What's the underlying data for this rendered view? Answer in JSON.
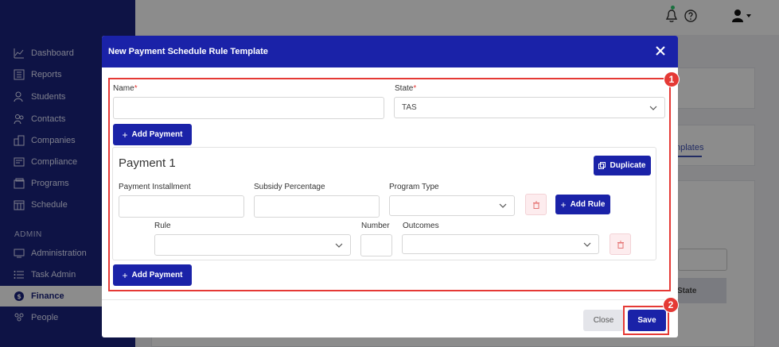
{
  "sidebar": {
    "items": [
      {
        "label": "Dashboard",
        "icon": "chart-line-icon"
      },
      {
        "label": "Reports",
        "icon": "report-icon"
      },
      {
        "label": "Students",
        "icon": "student-icon"
      },
      {
        "label": "Contacts",
        "icon": "contacts-icon"
      },
      {
        "label": "Companies",
        "icon": "building-icon"
      },
      {
        "label": "Compliance",
        "icon": "id-card-icon"
      },
      {
        "label": "Programs",
        "icon": "folder-icon"
      },
      {
        "label": "Schedule",
        "icon": "calendar-icon"
      }
    ],
    "section_label": "ADMIN",
    "admin_items": [
      {
        "label": "Administration",
        "icon": "monitor-icon"
      },
      {
        "label": "Task Admin",
        "icon": "list-icon"
      },
      {
        "label": "Finance",
        "icon": "coin-icon",
        "active": true
      },
      {
        "label": "People",
        "icon": "people-icon"
      }
    ]
  },
  "background": {
    "tab_link": "nplates",
    "table_header": "State"
  },
  "modal": {
    "title": "New Payment Schedule Rule Template",
    "name_label": "Name",
    "state_label": "State",
    "required_mark": "*",
    "name_value": "",
    "state_value": "TAS",
    "add_payment_label": "Add Payment",
    "payment": {
      "title": "Payment 1",
      "duplicate_label": "Duplicate",
      "installment_label": "Payment Installment",
      "subsidy_label": "Subsidy Percentage",
      "program_type_label": "Program Type",
      "add_rule_label": "Add Rule",
      "rule_label": "Rule",
      "number_label": "Number",
      "outcomes_label": "Outcomes"
    },
    "close_label": "Close",
    "save_label": "Save"
  },
  "annotations": {
    "one": "1",
    "two": "2"
  },
  "colors": {
    "sidebar": "#1a237e",
    "primary": "#1a22a8",
    "annotation": "#e53935"
  }
}
